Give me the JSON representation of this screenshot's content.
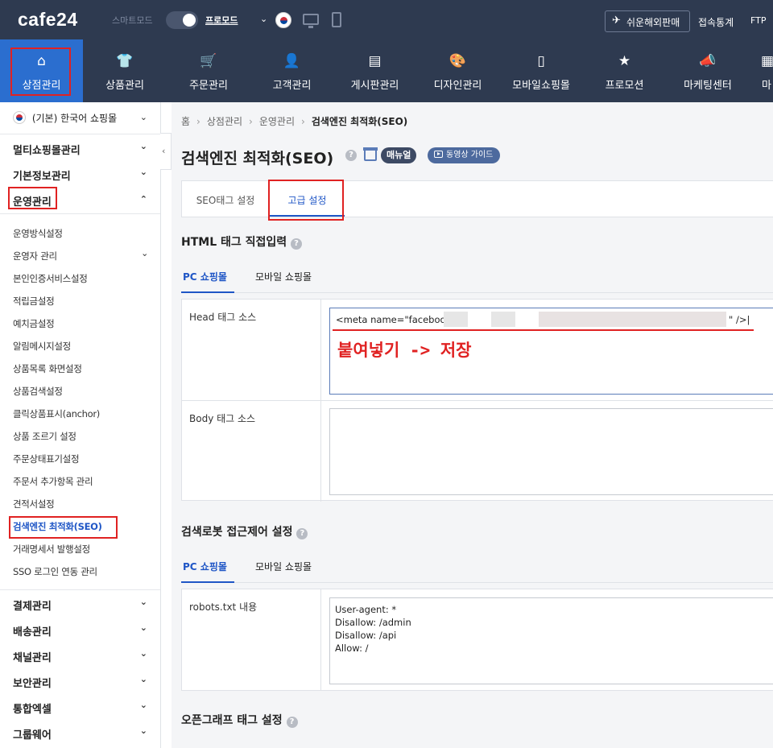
{
  "topbar": {
    "logo": "cafe24",
    "smart_mode": "스마트모드",
    "pro_mode": "프로모드",
    "dropdown_glyph": "⌄",
    "overseas_sale": "쉬운해외판매",
    "access_stats": "접속통계",
    "ftp": "FTP"
  },
  "main_nav": [
    {
      "label": "상점관리",
      "icon": "store-icon",
      "glyph": "⌂",
      "active": true
    },
    {
      "label": "상품관리",
      "icon": "tshirt-icon",
      "glyph": "👕"
    },
    {
      "label": "주문관리",
      "icon": "cart-icon",
      "glyph": "🛒"
    },
    {
      "label": "고객관리",
      "icon": "user-icon",
      "glyph": "👤"
    },
    {
      "label": "게시판관리",
      "icon": "board-icon",
      "glyph": "▤"
    },
    {
      "label": "디자인관리",
      "icon": "palette-icon",
      "glyph": "🎨"
    },
    {
      "label": "모바일쇼핑몰",
      "icon": "mobile-icon",
      "glyph": "▯"
    },
    {
      "label": "프로모션",
      "icon": "star-icon",
      "glyph": "★"
    },
    {
      "label": "마케팅센터",
      "icon": "megaphone-icon",
      "glyph": "📣"
    },
    {
      "label": "마",
      "icon": "more-icon",
      "glyph": "▦"
    }
  ],
  "sidebar": {
    "mall_selector": "(기본) 한국어 쇼핑몰",
    "groups_top": [
      {
        "label": "멀티쇼핑몰관리"
      },
      {
        "label": "기본정보관리"
      },
      {
        "label": "운영관리",
        "expanded": true
      }
    ],
    "sub_items": [
      {
        "label": "운영방식설정"
      },
      {
        "label": "운영자 관리",
        "has_children": true
      },
      {
        "label": "본인인증서비스설정"
      },
      {
        "label": "적립금설정"
      },
      {
        "label": "예치금설정"
      },
      {
        "label": "알림메시지설정"
      },
      {
        "label": "상품목록 화면설정"
      },
      {
        "label": "상품검색설정"
      },
      {
        "label": "클릭상품표시(anchor)"
      },
      {
        "label": "상품 조르기 설정"
      },
      {
        "label": "주문상태표기설정"
      },
      {
        "label": "주문서 추가항목 관리"
      },
      {
        "label": "견적서설정"
      },
      {
        "label": "검색엔진 최적화(SEO)",
        "active": true
      },
      {
        "label": "거래명세서 발행설정"
      },
      {
        "label": "SSO 로그인 연동 관리"
      }
    ],
    "groups_bottom": [
      {
        "label": "결제관리"
      },
      {
        "label": "배송관리"
      },
      {
        "label": "채널관리"
      },
      {
        "label": "보안관리"
      },
      {
        "label": "통합엑셀"
      },
      {
        "label": "그룹웨어"
      }
    ],
    "collapse_glyph": "‹"
  },
  "breadcrumb": [
    "홈",
    "상점관리",
    "운영관리",
    "검색엔진 최적화(SEO)"
  ],
  "page": {
    "title": "검색엔진 최적화(SEO)",
    "help": "?",
    "manual": "매뉴얼",
    "video_guide": "동영상 가이드"
  },
  "tabs": [
    {
      "label": "SEO태그 설정"
    },
    {
      "label": "고급 설정",
      "active": true
    }
  ],
  "html_tag_section": {
    "title": "HTML 태그 직접입력",
    "subtabs": [
      {
        "label": "PC 쇼핑몰",
        "active": true
      },
      {
        "label": "모바일 쇼핑몰"
      }
    ],
    "head_label": "Head 태그 소스",
    "head_value_start": "<meta name=\"facebook",
    "head_value_end": "\" />|",
    "annotation": "붙여넣기 -> 저장",
    "body_label": "Body 태그 소스",
    "body_value": ""
  },
  "robots_section": {
    "title": "검색로봇 접근제어 설정",
    "subtabs": [
      {
        "label": "PC 쇼핑몰",
        "active": true
      },
      {
        "label": "모바일 쇼핑몰"
      }
    ],
    "label": "robots.txt 내용",
    "value": "User-agent: *\nDisallow: /admin\nDisallow: /api\nAllow: /"
  },
  "og_section": {
    "title": "오픈그래프 태그 설정"
  },
  "colors": {
    "topbar": "#2e3a50",
    "active_nav": "#2b6ecf",
    "accent": "#1f56c6",
    "annotation_red": "#e02222"
  }
}
